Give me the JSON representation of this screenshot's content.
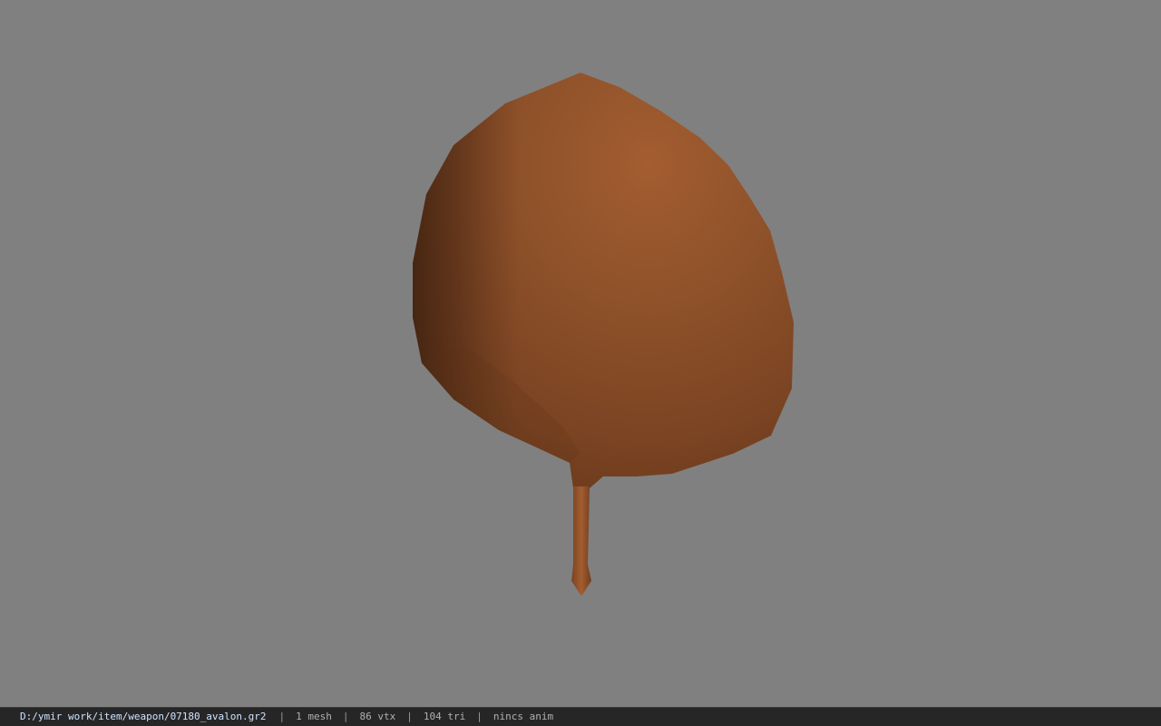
{
  "viewport": {
    "background_color": "#808080",
    "model_color": "#8b4e27",
    "model_highlight": "#a35d30",
    "model_shadow": "#4a2714"
  },
  "statusbar": {
    "file_path": "D:/ymir work/item/weapon/07180_avalon.gr2",
    "separator": "|",
    "mesh_count": "1 mesh",
    "vertex_count": "86 vtx",
    "triangle_count": "104 tri",
    "anim_status": "nincs anim"
  }
}
